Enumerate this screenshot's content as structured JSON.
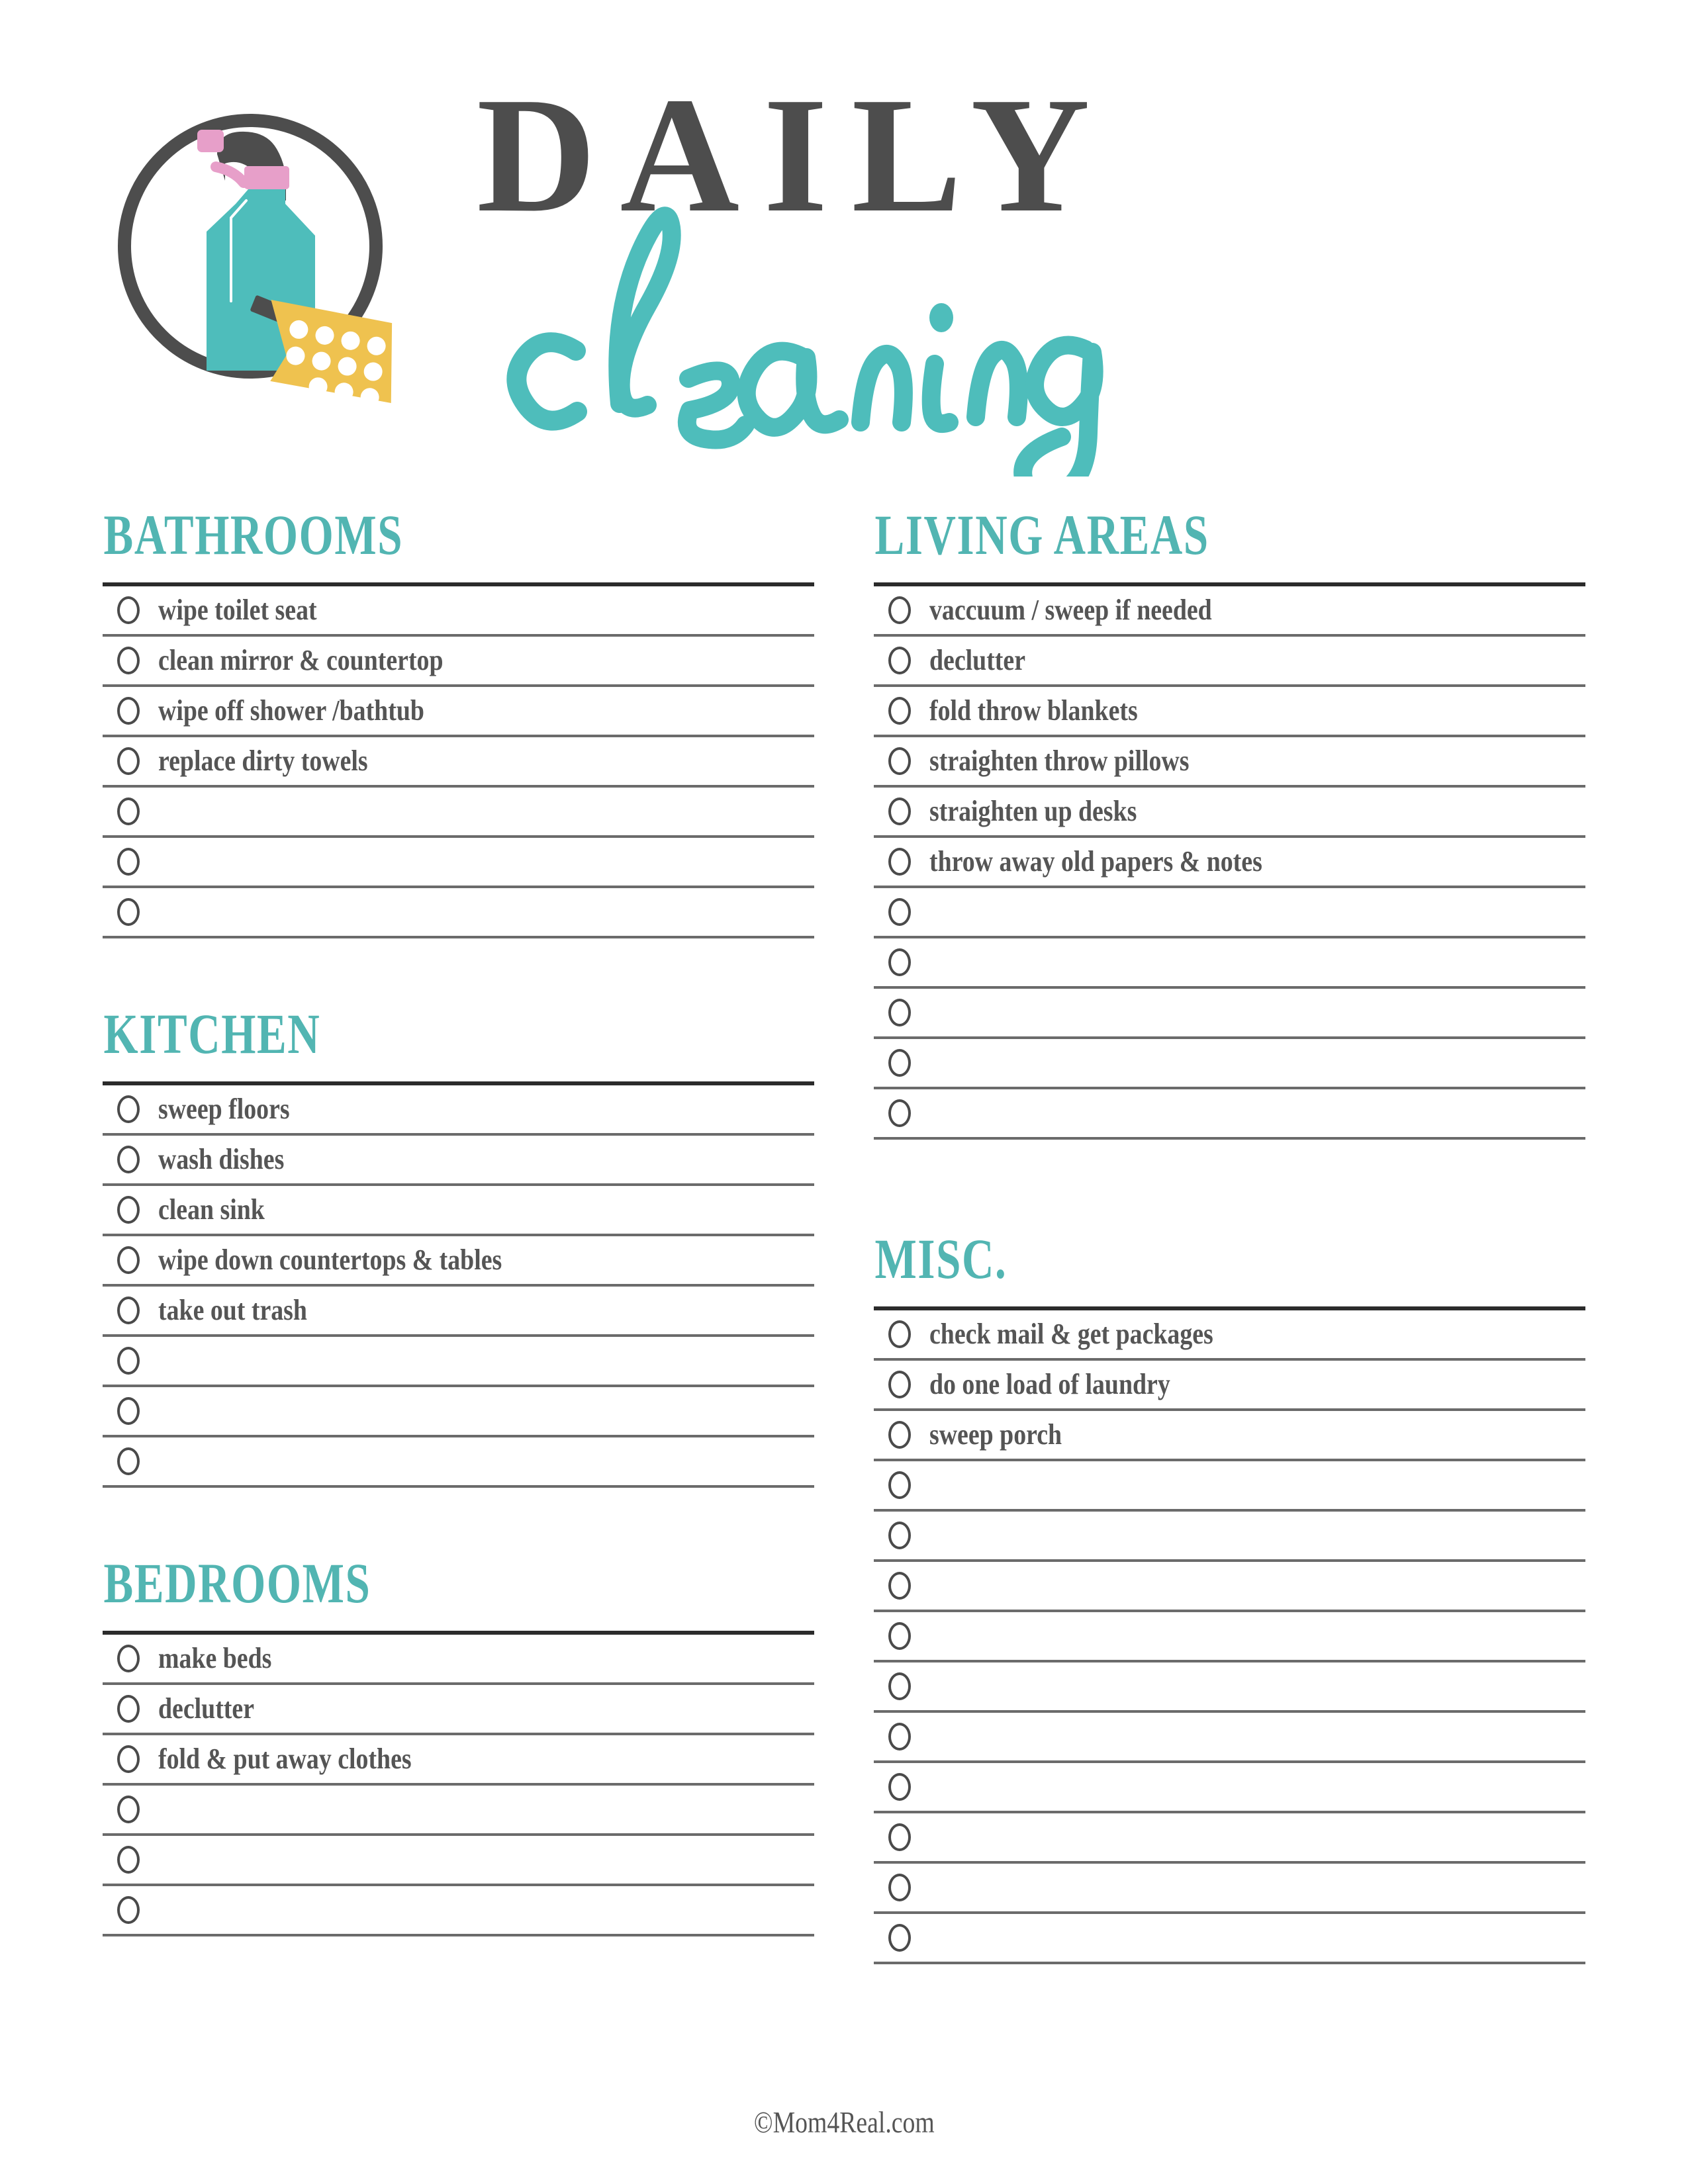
{
  "header": {
    "title_primary": "DAILY",
    "title_script": "cleaning",
    "logo_name": "spray-bottle-and-sponge-logo"
  },
  "colors": {
    "teal": "#52b5b2",
    "dark_gray": "#4d4d4d",
    "text_gray": "#555555",
    "rule_gray": "#6b6b6b",
    "rule_dark": "#2b2b2b",
    "pink": "#e79fc9",
    "yellow": "#efc24f",
    "bottle_teal": "#4ebdbb"
  },
  "columns": {
    "left": [
      {
        "title": "BATHROOMS",
        "rows": [
          "wipe toilet seat",
          "clean mirror & countertop",
          "wipe off shower /bathtub",
          "replace dirty towels",
          "",
          "",
          ""
        ]
      },
      {
        "title": "KITCHEN",
        "rows": [
          "sweep floors",
          "wash dishes",
          "clean sink",
          "wipe down countertops & tables",
          "take out trash",
          "",
          "",
          ""
        ]
      },
      {
        "title": "BEDROOMS",
        "rows": [
          "make beds",
          "declutter",
          "fold & put away clothes",
          "",
          "",
          ""
        ]
      }
    ],
    "right": [
      {
        "title": "LIVING AREAS",
        "rows": [
          "vaccuum / sweep if needed",
          "declutter",
          "fold throw blankets",
          "straighten throw pillows",
          "straighten up desks",
          "throw away old papers & notes",
          "",
          "",
          "",
          "",
          ""
        ]
      },
      {
        "title": "MISC.",
        "rows": [
          "check mail & get packages",
          "do one load of laundry",
          "sweep porch",
          "",
          "",
          "",
          "",
          "",
          "",
          "",
          "",
          "",
          ""
        ]
      }
    ]
  },
  "footer": {
    "copyright": "©Mom4Real.com"
  }
}
